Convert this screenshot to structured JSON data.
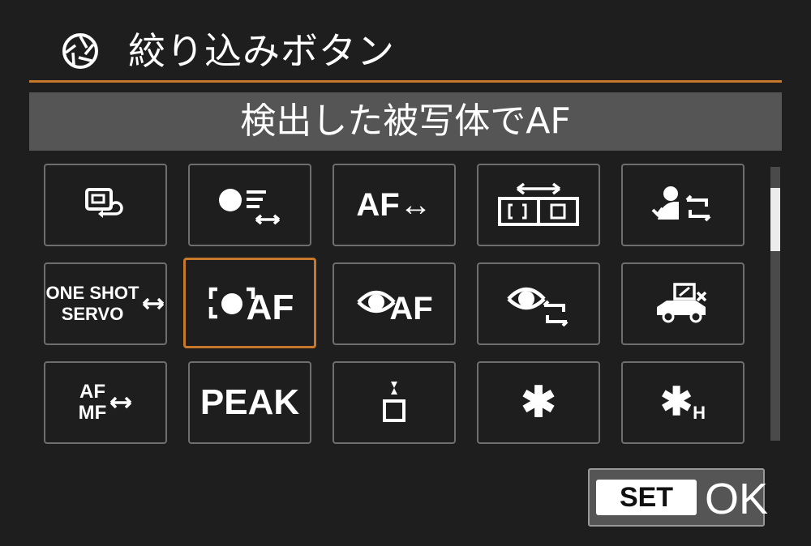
{
  "header": {
    "icon": "aperture-icon",
    "title": "絞り込みボタン"
  },
  "selected_function": "検出した被写体でAF",
  "accent_color": "#c8782a",
  "grid": {
    "selected_index": 6,
    "items": [
      {
        "icon": "playback-return-icon",
        "label": ""
      },
      {
        "icon": "tracking-switch-icon",
        "label": ""
      },
      {
        "icon": "af-area-switch-icon",
        "label": "AF↔"
      },
      {
        "icon": "registered-af-point-switch-icon",
        "label": ""
      },
      {
        "icon": "subject-switch-icon",
        "label": ""
      },
      {
        "icon": "one-shot-servo-switch-icon",
        "label": "ONE SHOT",
        "label2": "SERVO"
      },
      {
        "icon": "detected-subject-af-icon",
        "label": "AF"
      },
      {
        "icon": "eye-detection-af-icon",
        "label": "AF"
      },
      {
        "icon": "eye-switch-icon",
        "label": ""
      },
      {
        "icon": "vehicle-detection-icon",
        "label": ""
      },
      {
        "icon": "af-mf-switch-icon",
        "label": "AF",
        "label2": "MF"
      },
      {
        "icon": "peaking-icon",
        "label": "PEAK"
      },
      {
        "icon": "focus-guide-icon",
        "label": ""
      },
      {
        "icon": "ae-lock-icon",
        "label": "✱"
      },
      {
        "icon": "ae-lock-hold-icon",
        "label": "✱",
        "sub": "H"
      }
    ]
  },
  "footer": {
    "set_label": "SET",
    "ok_label": "OK"
  }
}
